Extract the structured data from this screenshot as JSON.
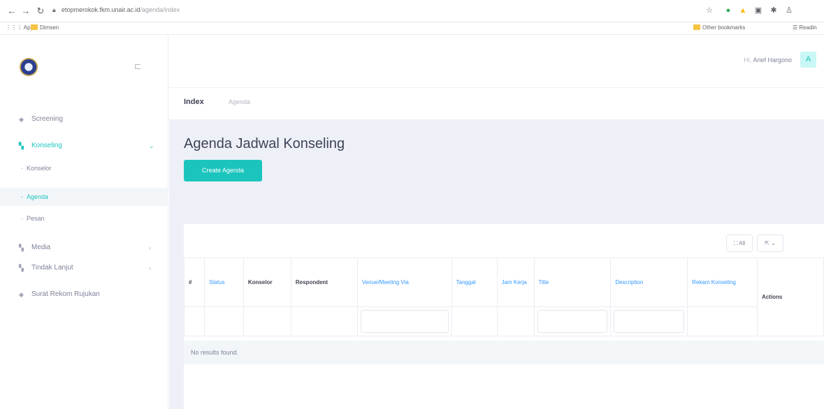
{
  "browser": {
    "url_host": "etopmerokok.fkm.unair.ac.id",
    "url_path": "/agenda/index",
    "bookmarks": {
      "apps": "Apps",
      "folder": "Dimsen",
      "other": "Other bookmarks",
      "reading": "Readin"
    },
    "colors": {
      "ext_green": "#34a853",
      "ext_yellow": "#fbbc04"
    }
  },
  "sidebar": {
    "items": [
      {
        "label": "Screening",
        "icon": "screening-icon"
      },
      {
        "label": "Konseling",
        "icon": "konseling-icon",
        "active": true
      },
      {
        "label": "Media",
        "icon": "media-icon"
      },
      {
        "label": "Tindak Lanjut",
        "icon": "tindak-lanjut-icon"
      },
      {
        "label": "Surat Rekom Rujukan",
        "icon": "surat-icon"
      }
    ],
    "konseling_sub": [
      {
        "label": "Konselor"
      },
      {
        "label": "Agenda",
        "selected": true
      },
      {
        "label": "Pesan"
      }
    ]
  },
  "header": {
    "greeting": "Hi,",
    "user_name": "Arief Hargono",
    "avatar_letter": "A"
  },
  "breadcrumb": {
    "title": "Index",
    "link": "Agenda"
  },
  "page": {
    "title": "Agenda Jadwal Konseling",
    "create_button": "Create Agenda"
  },
  "toolbar": {
    "all_label": "All"
  },
  "table": {
    "columns": [
      {
        "label": "#"
      },
      {
        "label": "Status",
        "sortable": true
      },
      {
        "label": "Konselor"
      },
      {
        "label": "Respondent"
      },
      {
        "label": "Venue/Meeting Via",
        "sortable": true
      },
      {
        "label": "Tanggal",
        "sortable": true
      },
      {
        "label": "Jam Kerja",
        "sortable": true
      },
      {
        "label": "Title",
        "sortable": true
      },
      {
        "label": "Description",
        "sortable": true
      },
      {
        "label": "Rekam Konseling",
        "sortable": true
      },
      {
        "label": "Actions"
      }
    ],
    "empty_message": "No results found."
  },
  "colors": {
    "accent": "#1bc5bd",
    "link": "#3699ff",
    "content_bg": "#eef0f8"
  }
}
